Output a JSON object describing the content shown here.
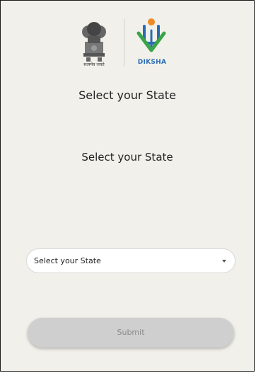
{
  "logos": {
    "emblem_icon": "national-emblem-icon",
    "emblem_caption": "सत्यमेव जयते",
    "diksha_icon": "diksha-logo-icon",
    "diksha_text": "DIKSHA",
    "diksha_text_color": "#2a6bb5",
    "diksha_colors": {
      "orange": "#f08a24",
      "green": "#3aa547",
      "blue": "#2a6bb5"
    }
  },
  "page": {
    "title": "Select your State",
    "subtitle": "Select your State"
  },
  "state_select": {
    "selected": "Select your State"
  },
  "submit": {
    "label": "Submit"
  },
  "colors": {
    "background": "#f1f0ea",
    "button_disabled": "#cfcfcf",
    "button_text": "#8a8a8a"
  }
}
